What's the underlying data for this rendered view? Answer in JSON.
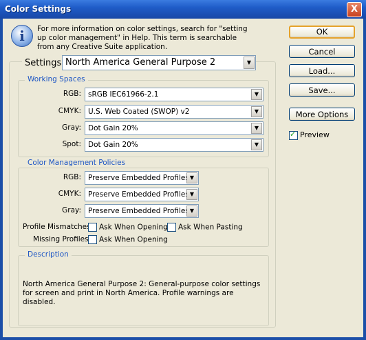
{
  "window": {
    "title": "Color Settings",
    "close_glyph": "X"
  },
  "info": {
    "icon": "info-icon",
    "text": "For more information on color settings, search for \"setting up color management\" in Help. This term is searchable from any Creative Suite application."
  },
  "buttons": {
    "ok": "OK",
    "cancel": "Cancel",
    "load": "Load...",
    "save": "Save...",
    "more_options": "More Options"
  },
  "preview": {
    "label": "Preview",
    "checked": true
  },
  "settings": {
    "label": "Settings:",
    "value": "North America General Purpose 2"
  },
  "working_spaces": {
    "legend": "Working Spaces",
    "rows": [
      {
        "label": "RGB:",
        "value": "sRGB IEC61966-2.1"
      },
      {
        "label": "CMYK:",
        "value": "U.S. Web Coated (SWOP) v2"
      },
      {
        "label": "Gray:",
        "value": "Dot Gain 20%"
      },
      {
        "label": "Spot:",
        "value": "Dot Gain 20%"
      }
    ]
  },
  "policies": {
    "legend": "Color Management Policies",
    "rows": [
      {
        "label": "RGB:",
        "value": "Preserve Embedded Profiles"
      },
      {
        "label": "CMYK:",
        "value": "Preserve Embedded Profiles"
      },
      {
        "label": "Gray:",
        "value": "Preserve Embedded Profiles"
      }
    ],
    "mismatches_label": "Profile Mismatches:",
    "ask_opening": "Ask When Opening",
    "ask_pasting": "Ask When Pasting",
    "missing_label": "Missing Profiles:",
    "missing_ask_opening": "Ask When Opening"
  },
  "description": {
    "legend": "Description",
    "text": "North America General Purpose 2:  General-purpose color settings for screen and print in North America. Profile warnings are disabled."
  }
}
